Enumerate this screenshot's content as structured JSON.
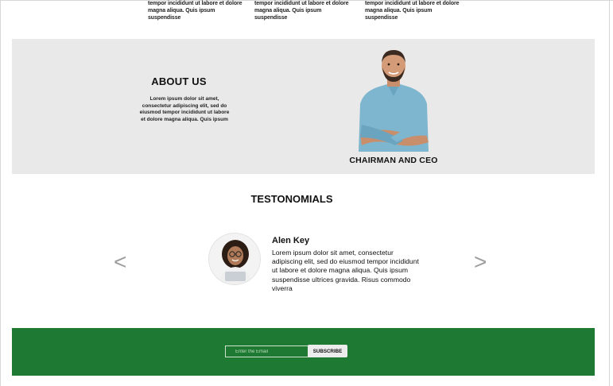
{
  "features": {
    "item1": "tempor incididunt ut labore et dolore magna aliqua. Quis ipsum suspendisse",
    "item2": "tempor incididunt ut labore et dolore magna aliqua. Quis ipsum suspendisse",
    "item3": "tempor incididunt ut labore et dolore magna aliqua. Quis ipsum suspendisse"
  },
  "about": {
    "title": "ABOUT US",
    "text": "Lorem ipsum dolor sit amet, consectetur adipiscing elit, sed do eiusmod tempor incididunt ut labore et dolore magna aliqua. Quis ipsum",
    "caption": "CHAIRMAN AND CEO"
  },
  "testimonials": {
    "title": "TESTONOMIALS",
    "prev": "<",
    "next": ">",
    "name": "Alen Key",
    "text": "Lorem ipsum dolor sit amet, consectetur adipiscing elit, sed do eiusmod tempor incididunt ut labore et dolore magna aliqua. Quis ipsum suspendisse ultrices gravida. Risus commodo viverra"
  },
  "newsletter": {
    "email_placeholder": "Enter the Email",
    "subscribe_label": "SUBSCRIBE"
  },
  "colors": {
    "about_bg": "#e9e9e9",
    "newsletter_bg": "#1e7a32",
    "arrow": "#9d9d9d"
  }
}
